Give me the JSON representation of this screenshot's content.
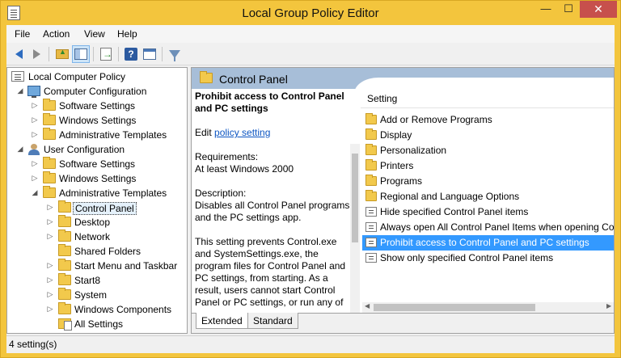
{
  "window": {
    "title": "Local Group Policy Editor",
    "minimize": "—",
    "maximize": "☐",
    "close": "✕"
  },
  "menu": [
    "File",
    "Action",
    "View",
    "Help"
  ],
  "tree": [
    {
      "label": "Local Computer Policy",
      "expander": "",
      "icon": "policy-icon"
    },
    {
      "label": "Computer Configuration",
      "expander": "◢",
      "icon": "computer-icon"
    },
    {
      "label": "Software Settings",
      "expander": "▷",
      "icon": "folder-icon"
    },
    {
      "label": "Windows Settings",
      "expander": "▷",
      "icon": "folder-icon"
    },
    {
      "label": "Administrative Templates",
      "expander": "▷",
      "icon": "folder-icon"
    },
    {
      "label": "User Configuration",
      "expander": "◢",
      "icon": "user-icon"
    },
    {
      "label": "Software Settings",
      "expander": "▷",
      "icon": "folder-icon"
    },
    {
      "label": "Windows Settings",
      "expander": "▷",
      "icon": "folder-icon"
    },
    {
      "label": "Administrative Templates",
      "expander": "◢",
      "icon": "folder-icon"
    },
    {
      "label": "Control Panel",
      "expander": "▷",
      "icon": "folder-icon",
      "selected": true
    },
    {
      "label": "Desktop",
      "expander": "▷",
      "icon": "folder-icon"
    },
    {
      "label": "Network",
      "expander": "▷",
      "icon": "folder-icon"
    },
    {
      "label": "Shared Folders",
      "expander": "",
      "icon": "folder-icon"
    },
    {
      "label": "Start Menu and Taskbar",
      "expander": "▷",
      "icon": "folder-icon"
    },
    {
      "label": "Start8",
      "expander": "▷",
      "icon": "folder-icon"
    },
    {
      "label": "System",
      "expander": "▷",
      "icon": "folder-icon"
    },
    {
      "label": "Windows Components",
      "expander": "▷",
      "icon": "folder-icon"
    },
    {
      "label": "All Settings",
      "expander": "",
      "icon": "all-settings-icon"
    }
  ],
  "panel": {
    "title": "Control Panel",
    "description": {
      "heading": "Prohibit access to Control Panel and PC settings",
      "edit_prefix": "Edit",
      "edit_link": "policy setting",
      "requirements_label": "Requirements:",
      "requirements_value": "At least Windows 2000",
      "description_label": "Description:",
      "description_p1": "Disables all Control Panel programs and the PC settings app.",
      "description_p2": "This setting prevents Control.exe and SystemSettings.exe, the program files for Control Panel and PC settings, from starting. As a result, users cannot start Control Panel or PC settings, or run any of"
    },
    "column_header": "Setting",
    "settings": [
      {
        "label": "Add or Remove Programs",
        "icon": "folder-icon"
      },
      {
        "label": "Display",
        "icon": "folder-icon"
      },
      {
        "label": "Personalization",
        "icon": "folder-icon"
      },
      {
        "label": "Printers",
        "icon": "folder-icon"
      },
      {
        "label": "Programs",
        "icon": "folder-icon"
      },
      {
        "label": "Regional and Language Options",
        "icon": "folder-icon"
      },
      {
        "label": "Hide specified Control Panel items",
        "icon": "setting-icon"
      },
      {
        "label": "Always open All Control Panel Items when opening Co",
        "icon": "setting-icon"
      },
      {
        "label": "Prohibit access to Control Panel and PC settings",
        "icon": "setting-icon",
        "selected": true
      },
      {
        "label": "Show only specified Control Panel items",
        "icon": "setting-icon"
      }
    ],
    "tabs": [
      "Extended",
      "Standard"
    ],
    "active_tab": "Extended"
  },
  "status": {
    "text": "4 setting(s)"
  },
  "colors": {
    "title_bar": "#f3c53d",
    "selection": "#3399ff",
    "header": "#a7bed8",
    "close_button": "#c7504c"
  }
}
